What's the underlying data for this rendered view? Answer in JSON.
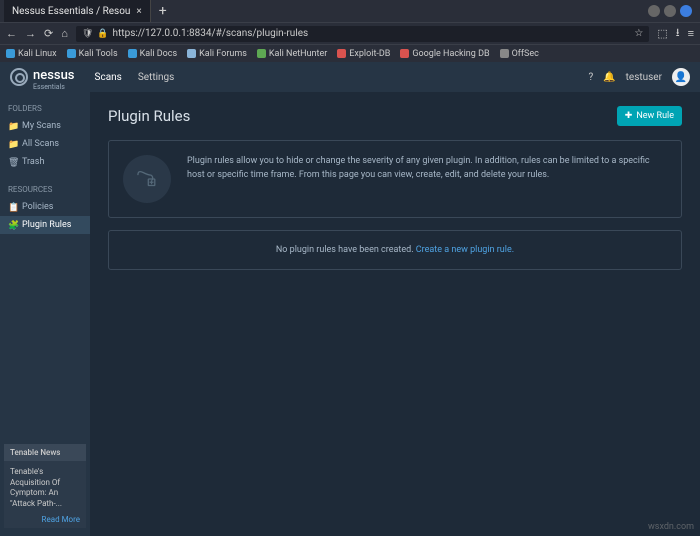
{
  "browser": {
    "tab_title": "Nessus Essentials / Resou",
    "url": "https://127.0.0.1:8834/#/scans/plugin-rules"
  },
  "bookmarks": [
    {
      "label": "Kali Linux"
    },
    {
      "label": "Kali Tools"
    },
    {
      "label": "Kali Docs"
    },
    {
      "label": "Kali Forums"
    },
    {
      "label": "Kali NetHunter"
    },
    {
      "label": "Exploit-DB"
    },
    {
      "label": "Google Hacking DB"
    },
    {
      "label": "OffSec"
    }
  ],
  "app": {
    "brand": "nessus",
    "sub": "Essentials",
    "nav_scans": "Scans",
    "nav_settings": "Settings",
    "user": "testuser"
  },
  "sidebar": {
    "folders_hdr": "FOLDERS",
    "folders": [
      {
        "label": "My Scans"
      },
      {
        "label": "All Scans"
      },
      {
        "label": "Trash"
      }
    ],
    "resources_hdr": "RESOURCES",
    "resources": [
      {
        "label": "Policies"
      },
      {
        "label": "Plugin Rules"
      }
    ]
  },
  "page": {
    "title": "Plugin Rules",
    "new_btn": "New Rule",
    "info": "Plugin rules allow you to hide or change the severity of any given plugin. In addition, rules can be limited to a specific host or specific time frame. From this page you can view, create, edit, and delete your rules.",
    "empty_prefix": "No plugin rules have been created. ",
    "empty_link": "Create a new plugin rule."
  },
  "news": {
    "hdr": "Tenable News",
    "body": "Tenable's Acquisition Of Cymptom: An \"Attack Path-...",
    "link": "Read More"
  },
  "watermark": "wsxdn.com"
}
